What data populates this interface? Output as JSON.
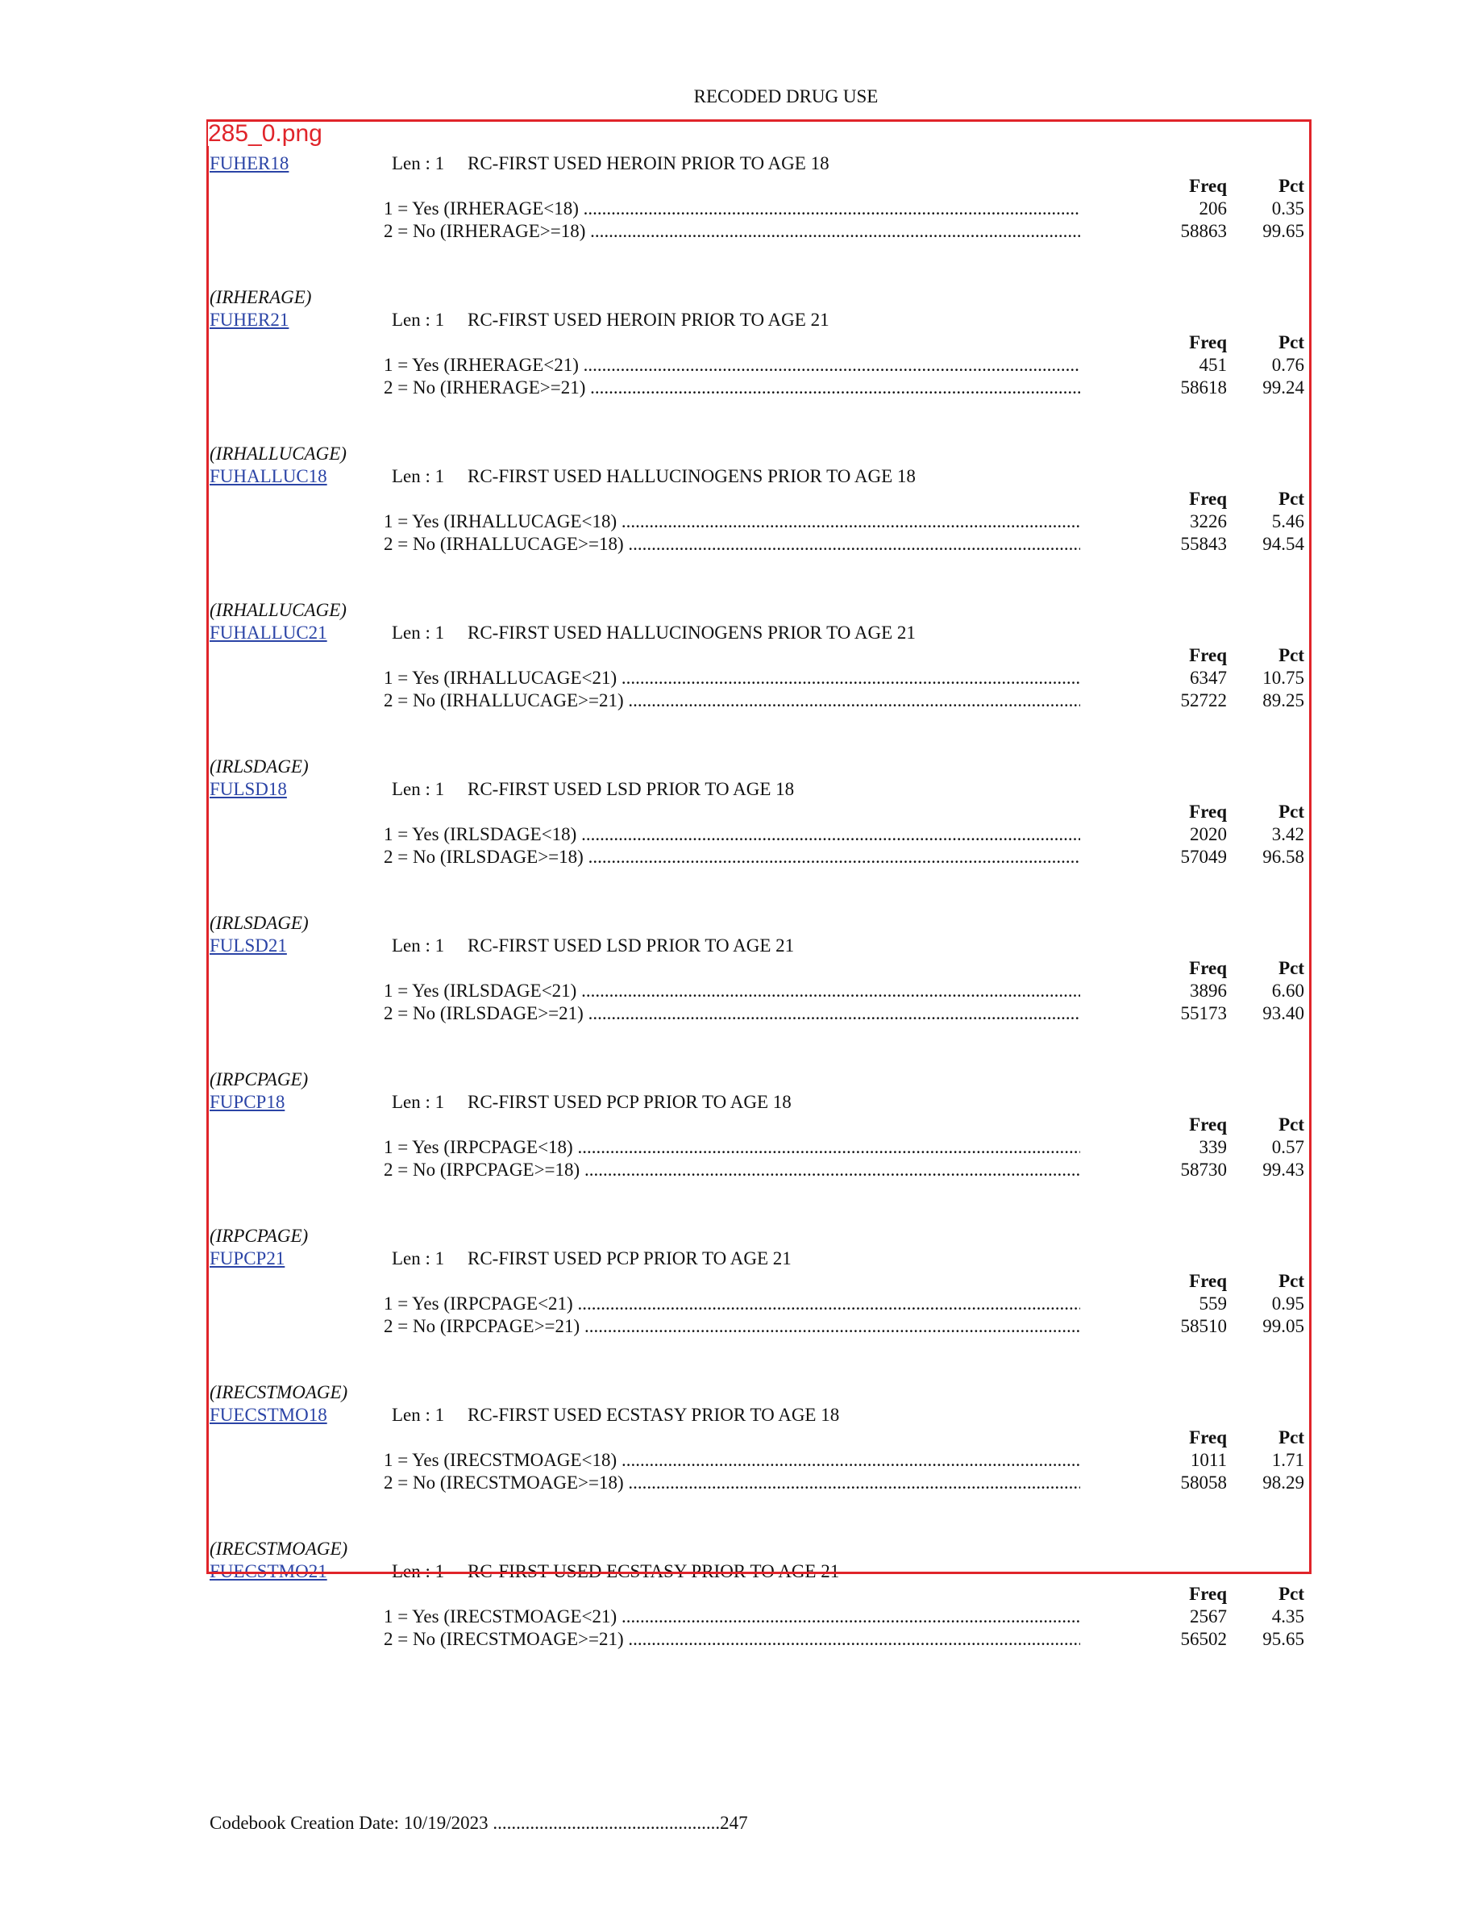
{
  "header": {
    "title": "RECODED DRUG USE"
  },
  "overlay": {
    "label": "285_0.png",
    "border_color": "#e0242a"
  },
  "link_color": "#2b44a6",
  "columns": {
    "freq": "Freq",
    "pct": "Pct"
  },
  "len_label": "Len : 1",
  "entries": [
    {
      "source": "",
      "name": "FUHER18",
      "desc": "RC-FIRST USED HEROIN PRIOR TO AGE 18",
      "rows": [
        {
          "label": "1 = Yes (IRHERAGE<18)",
          "freq": "206",
          "pct": "0.35"
        },
        {
          "label": "2 = No (IRHERAGE>=18)",
          "freq": "58863",
          "pct": "99.65"
        }
      ]
    },
    {
      "source": "(IRHERAGE)",
      "name": "FUHER21",
      "desc": "RC-FIRST USED HEROIN PRIOR TO AGE 21",
      "rows": [
        {
          "label": "1 = Yes (IRHERAGE<21)",
          "freq": "451",
          "pct": "0.76"
        },
        {
          "label": "2 = No (IRHERAGE>=21)",
          "freq": "58618",
          "pct": "99.24"
        }
      ]
    },
    {
      "source": "(IRHALLUCAGE)",
      "name": "FUHALLUC18",
      "desc": "RC-FIRST USED HALLUCINOGENS PRIOR TO AGE 18",
      "rows": [
        {
          "label": "1 = Yes (IRHALLUCAGE<18)",
          "freq": "3226",
          "pct": "5.46"
        },
        {
          "label": "2 = No (IRHALLUCAGE>=18)",
          "freq": "55843",
          "pct": "94.54"
        }
      ]
    },
    {
      "source": "(IRHALLUCAGE)",
      "name": "FUHALLUC21",
      "desc": "RC-FIRST USED HALLUCINOGENS PRIOR TO AGE 21",
      "rows": [
        {
          "label": "1 = Yes (IRHALLUCAGE<21)",
          "freq": "6347",
          "pct": "10.75"
        },
        {
          "label": "2 = No (IRHALLUCAGE>=21)",
          "freq": "52722",
          "pct": "89.25"
        }
      ]
    },
    {
      "source": "(IRLSDAGE)",
      "name": "FULSD18",
      "desc": "RC-FIRST USED LSD PRIOR TO AGE 18",
      "rows": [
        {
          "label": "1 = Yes (IRLSDAGE<18)",
          "freq": "2020",
          "pct": "3.42"
        },
        {
          "label": "2 = No (IRLSDAGE>=18)",
          "freq": "57049",
          "pct": "96.58"
        }
      ]
    },
    {
      "source": "(IRLSDAGE)",
      "name": "FULSD21",
      "desc": "RC-FIRST USED LSD PRIOR TO AGE 21",
      "rows": [
        {
          "label": "1 = Yes (IRLSDAGE<21)",
          "freq": "3896",
          "pct": "6.60"
        },
        {
          "label": "2 = No (IRLSDAGE>=21)",
          "freq": "55173",
          "pct": "93.40"
        }
      ]
    },
    {
      "source": "(IRPCPAGE)",
      "name": "FUPCP18",
      "desc": "RC-FIRST USED PCP PRIOR TO AGE 18",
      "rows": [
        {
          "label": "1 = Yes (IRPCPAGE<18)",
          "freq": "339",
          "pct": "0.57"
        },
        {
          "label": "2 = No (IRPCPAGE>=18)",
          "freq": "58730",
          "pct": "99.43"
        }
      ]
    },
    {
      "source": "(IRPCPAGE)",
      "name": "FUPCP21",
      "desc": "RC-FIRST USED PCP PRIOR TO AGE 21",
      "rows": [
        {
          "label": "1 = Yes (IRPCPAGE<21)",
          "freq": "559",
          "pct": "0.95"
        },
        {
          "label": "2 = No (IRPCPAGE>=21)",
          "freq": "58510",
          "pct": "99.05"
        }
      ]
    },
    {
      "source": "(IRECSTMOAGE)",
      "name": "FUECSTMO18",
      "desc": "RC-FIRST USED ECSTASY PRIOR TO AGE 18",
      "rows": [
        {
          "label": "1 = Yes (IRECSTMOAGE<18)",
          "freq": "1011",
          "pct": "1.71"
        },
        {
          "label": "2 = No (IRECSTMOAGE>=18)",
          "freq": "58058",
          "pct": "98.29"
        }
      ]
    },
    {
      "source": "(IRECSTMOAGE)",
      "name": "FUECSTMO21",
      "desc": "RC-FIRST USED ECSTASY PRIOR TO AGE 21",
      "rows": [
        {
          "label": "1 = Yes (IRECSTMOAGE<21)",
          "freq": "2567",
          "pct": "4.35"
        },
        {
          "label": "2 = No (IRECSTMOAGE>=21)",
          "freq": "56502",
          "pct": "95.65"
        }
      ]
    }
  ],
  "footer": {
    "text": "Codebook Creation Date: 10/19/2023 .................................................247"
  }
}
